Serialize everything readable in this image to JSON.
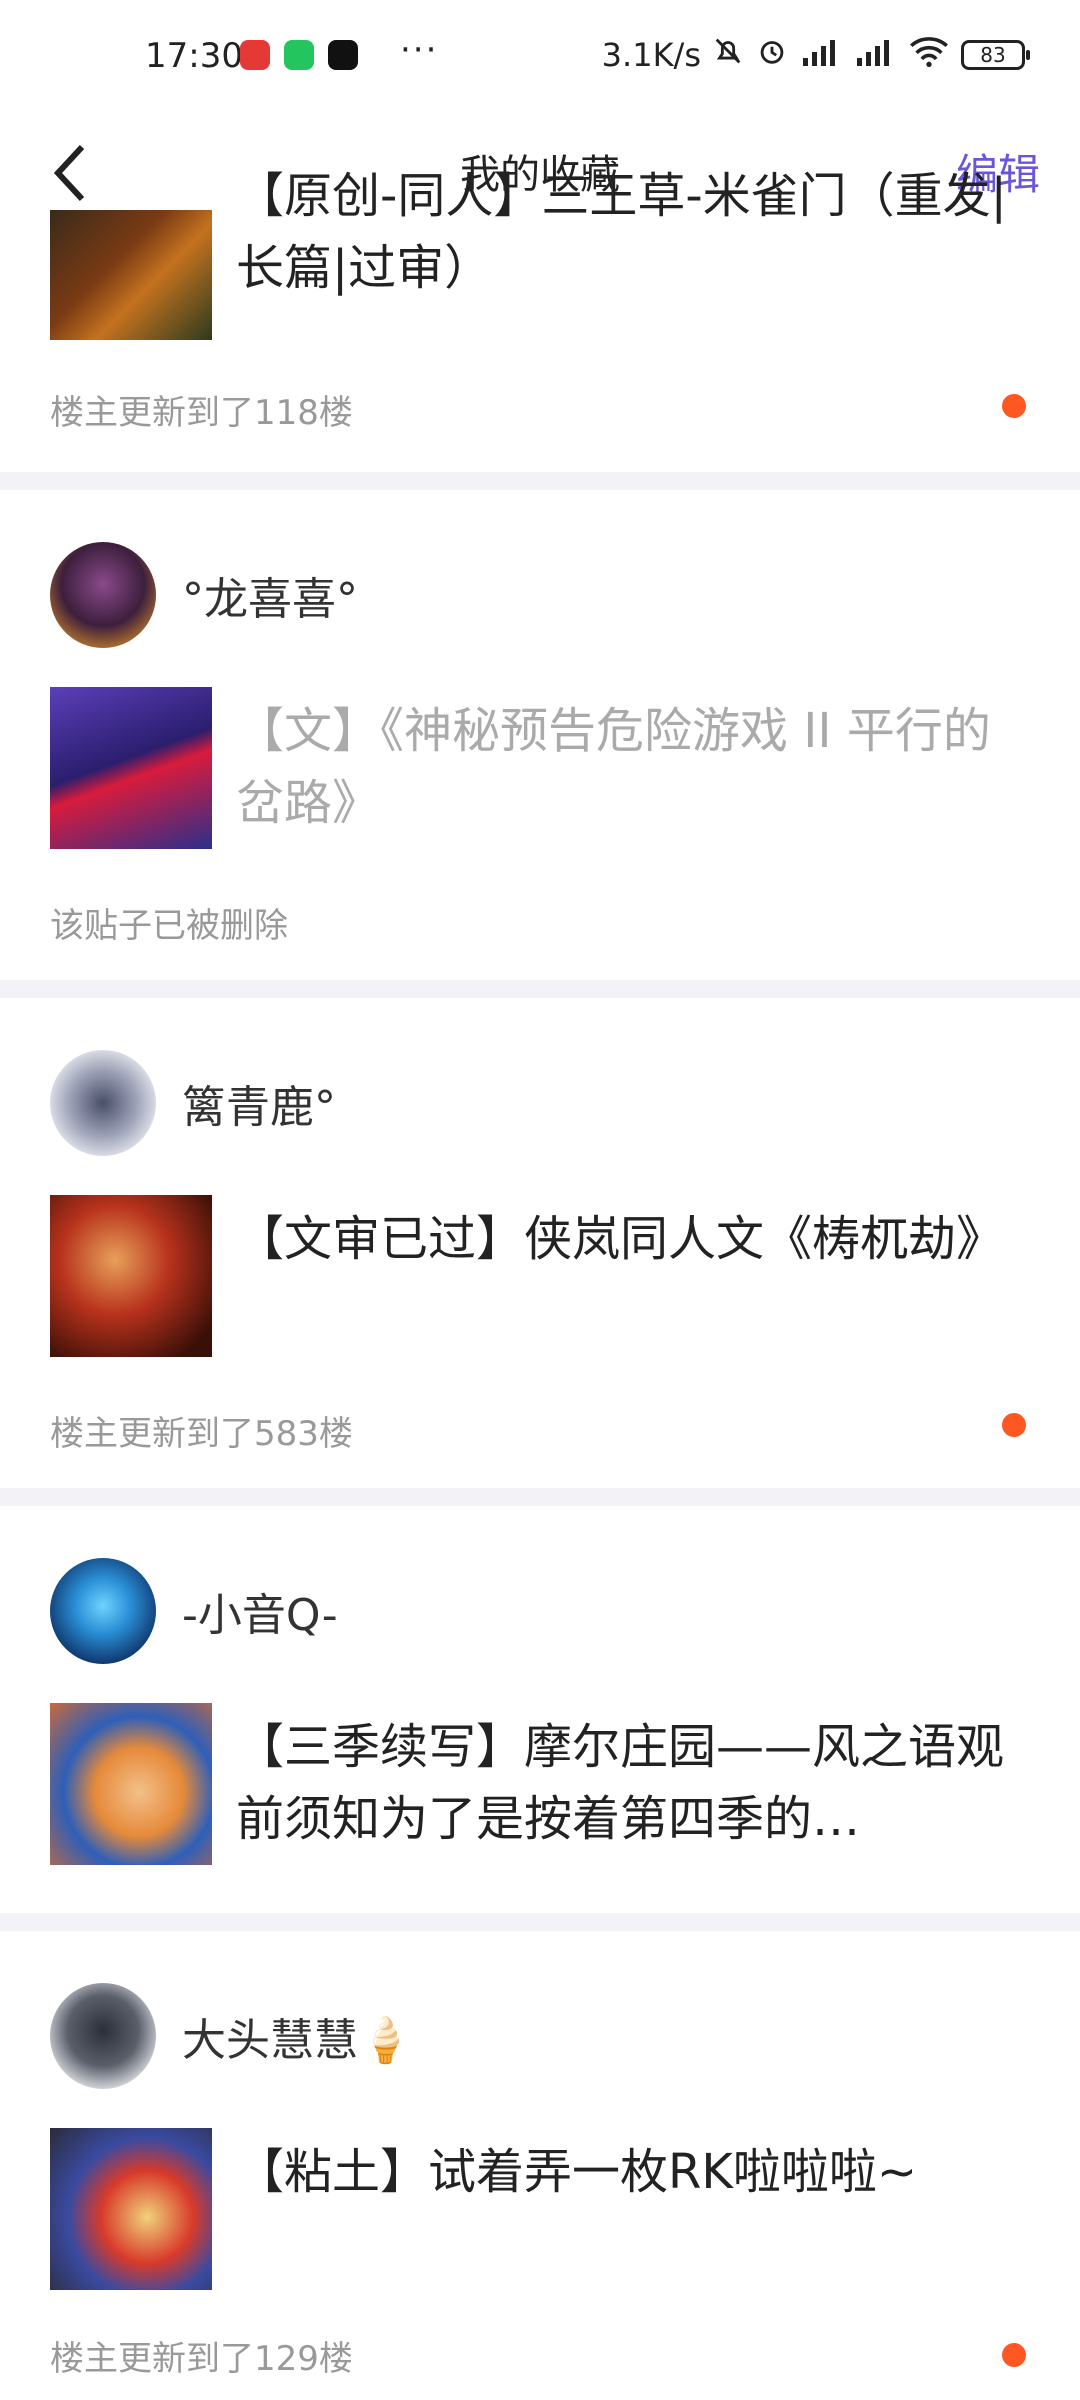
{
  "status_bar": {
    "time": "17:30",
    "net_speed": "3.1K/s",
    "battery": "83",
    "more": "···"
  },
  "header": {
    "title": "我的收藏",
    "edit_label": "编辑"
  },
  "posts": [
    {
      "username": "",
      "title": "【原创-同人】三王草-米雀门（重发|长篇|过审）",
      "meta": "楼主更新到了118楼",
      "has_update_dot": true,
      "deleted": false
    },
    {
      "username": "°龙喜喜°",
      "title": "【文】《神秘预告危险游戏 II 平行的岔路》",
      "meta": "该贴子已被删除",
      "has_update_dot": false,
      "deleted": true
    },
    {
      "username": "篱青鹿°",
      "title": "【文审已过】侠岚同人文《梼杌劫》",
      "meta": "楼主更新到了583楼",
      "has_update_dot": true,
      "deleted": false
    },
    {
      "username": "-小音Q-",
      "title": "【三季续写】摩尔庄园——风之语观前须知为了是按着第四季的…",
      "meta": "",
      "has_update_dot": false,
      "deleted": false
    },
    {
      "username": "大头慧慧🍦",
      "title": "【粘土】试着弄一枚RK啦啦啦~",
      "meta": "楼主更新到了129楼",
      "has_update_dot": true,
      "deleted": false
    }
  ],
  "colors": {
    "accent": "#6b55d9",
    "update_dot": "#ff5722",
    "separator": "#f3f3f7",
    "meta_text": "#999999"
  }
}
